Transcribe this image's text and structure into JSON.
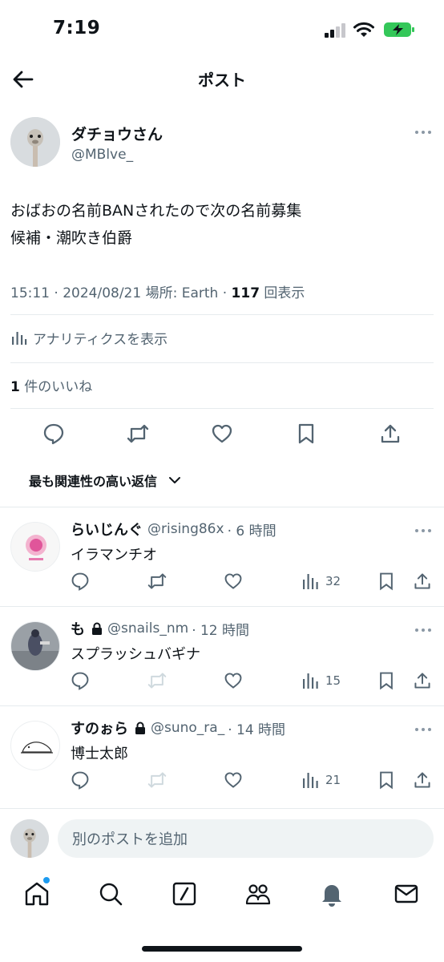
{
  "status_bar": {
    "time": "7:19",
    "battery_icon": "battery-charging-icon",
    "battery_color": "#34c759"
  },
  "header": {
    "title": "ポスト",
    "back_icon": "back-arrow-icon"
  },
  "post": {
    "author_name": "ダチョウさん",
    "author_handle": "@MBlve_",
    "text_line1": "おばおの名前BANされたので次の名前募集",
    "text_line2": "候補・潮吹き伯爵",
    "meta_time": "15:11 · 2024/08/21 場所: Earth · ",
    "meta_views": "117",
    "meta_views_suffix": " 回表示",
    "analytics_label": "アナリティクスを表示",
    "likes_count": "1",
    "likes_suffix": " 件のいいね",
    "actions": [
      "reply-icon",
      "repost-icon",
      "like-icon",
      "bookmark-icon",
      "share-icon"
    ]
  },
  "sort": {
    "label": "最も関連性の高い返信"
  },
  "replies": [
    {
      "name": "らいじんぐ",
      "locked": false,
      "handle": "@rising86x",
      "time": "· 6 時間",
      "text": "イラマンチオ",
      "views": "32"
    },
    {
      "name": "も",
      "locked": true,
      "handle": "@snails_nm",
      "time": "· 12 時間",
      "text": "スプラッシュバギナ",
      "views": "15"
    },
    {
      "name": "すのぉら",
      "locked": true,
      "handle": "@suno_ra_",
      "time": "· 14 時間",
      "text": "博士太郎",
      "views": "21"
    }
  ],
  "compose": {
    "placeholder": "別のポストを追加"
  },
  "tab_bar": {
    "items": [
      "home-icon",
      "search-icon",
      "grok-icon",
      "communities-icon",
      "notifications-icon",
      "messages-icon"
    ],
    "accent": "#1d9bf0"
  }
}
